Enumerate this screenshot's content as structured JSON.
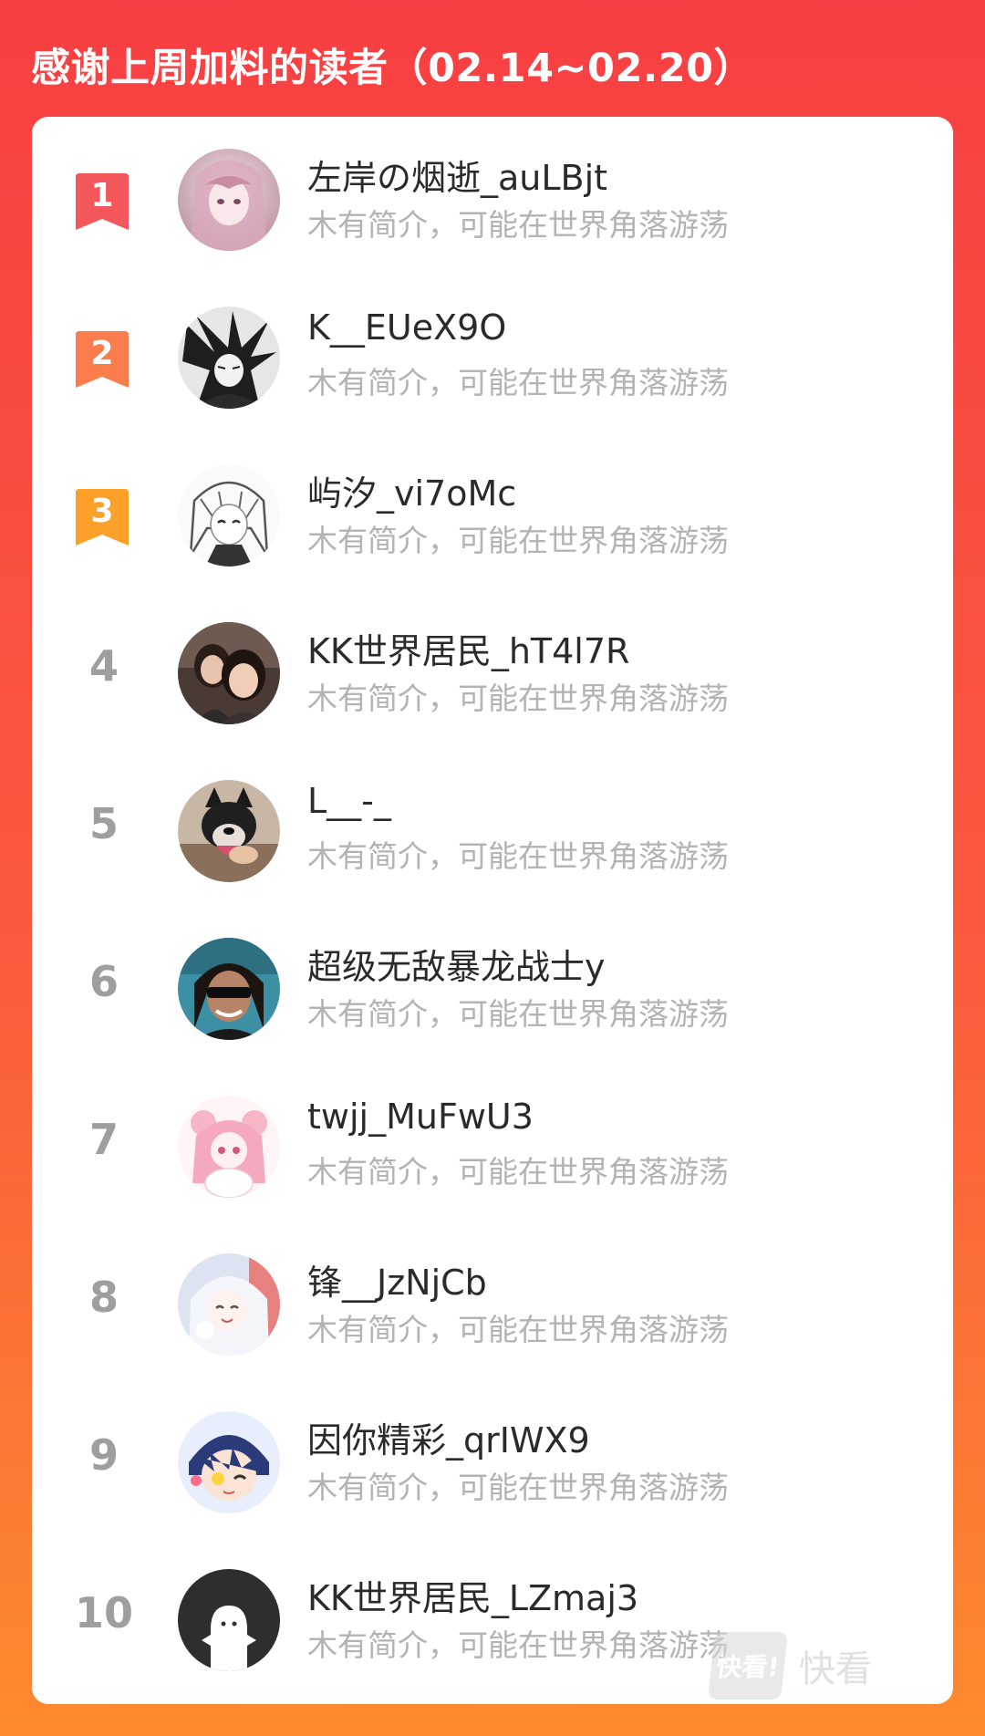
{
  "header": {
    "title": "感谢上周加料的读者（02.14~02.20）"
  },
  "readers": [
    {
      "rank": "1",
      "name": "左岸の烟逝_auLBjt",
      "bio": "木有简介，可能在世界角落游荡",
      "badge_color": "#f3565b",
      "avatar": "anime-girl-pink-avatar"
    },
    {
      "rank": "2",
      "name": "K__EUeX9O",
      "bio": "木有简介，可能在世界角落游荡",
      "badge_color": "#fb7d4e",
      "avatar": "anime-boy-sketch-avatar"
    },
    {
      "rank": "3",
      "name": "屿汐_vi7oMc",
      "bio": "木有简介，可能在世界角落游荡",
      "badge_color": "#fba12a",
      "avatar": "anime-girl-sketch-avatar"
    },
    {
      "rank": "4",
      "name": "KK世界居民_hT4l7R",
      "bio": "木有简介，可能在世界角落游荡",
      "avatar": "two-girls-photo-avatar"
    },
    {
      "rank": "5",
      "name": "L__-_",
      "bio": "木有简介，可能在世界角落游荡",
      "avatar": "dog-photo-avatar"
    },
    {
      "rank": "6",
      "name": "超级无敌暴龙战士y",
      "bio": "木有简介，可能在世界角落游荡",
      "avatar": "man-sunglasses-avatar"
    },
    {
      "rank": "7",
      "name": "twjj_MuFwU3",
      "bio": "木有简介，可能在世界角落游荡",
      "avatar": "anime-pink-hair-avatar"
    },
    {
      "rank": "8",
      "name": "锋__JzNjCb",
      "bio": "木有简介，可能在世界角落游荡",
      "avatar": "anime-white-hair-avatar"
    },
    {
      "rank": "9",
      "name": "因你精彩_qrIWX9",
      "bio": "木有简介，可能在世界角落游荡",
      "avatar": "anime-boy-chibi-avatar"
    },
    {
      "rank": "10",
      "name": "KK世界居民_LZmaj3",
      "bio": "木有简介，可能在世界角落游荡",
      "avatar": "default-ghost-avatar"
    }
  ],
  "watermark": {
    "logo_text": "快看!",
    "text": "快看"
  },
  "colors": {
    "gradient_top": "#f83f43",
    "gradient_bottom": "#fd8a2e",
    "rank_gray": "#9e9e9e"
  }
}
